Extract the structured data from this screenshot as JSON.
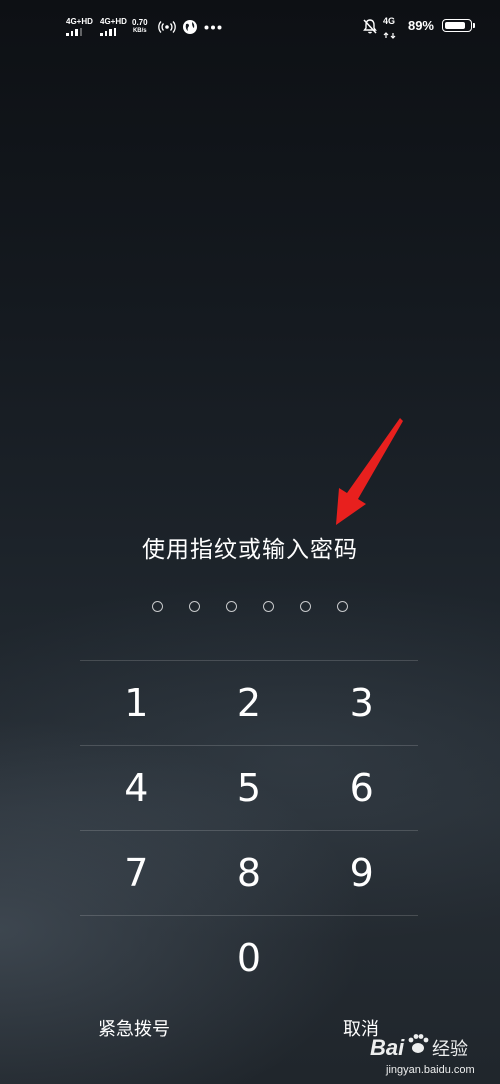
{
  "status_bar": {
    "sim1_network": "4G+HD",
    "sim2_network": "4G+HD",
    "speed_value": "0.70",
    "speed_unit": "KB/s",
    "mobile_data": "4G",
    "battery_percent": "89%",
    "battery_level": 0.89,
    "icons": [
      "signal-icon",
      "signal-icon",
      "hotspot-icon",
      "vpn-globe-icon",
      "more-dots-icon",
      "mute-bell-icon",
      "data-arrows-icon",
      "battery-icon"
    ]
  },
  "lock": {
    "prompt": "使用指纹或输入密码",
    "pin_length": 6,
    "keys": [
      [
        "1",
        "2",
        "3"
      ],
      [
        "4",
        "5",
        "6"
      ],
      [
        "7",
        "8",
        "9"
      ],
      [
        "",
        "0",
        ""
      ]
    ],
    "emergency_call": "紧急拨号",
    "cancel": "取消"
  },
  "annotation": {
    "arrow_color": "#e8201e"
  },
  "watermark": {
    "brand": "Bai",
    "brand_suffix": "经验",
    "url": "jingyan.baidu.com"
  }
}
